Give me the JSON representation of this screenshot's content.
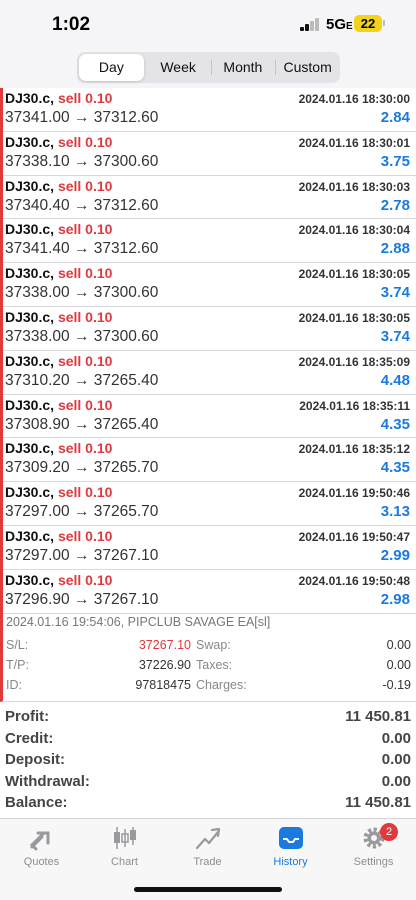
{
  "status": {
    "time": "1:02",
    "network": "5G",
    "network_suffix": "E",
    "battery": "22"
  },
  "tabs": [
    {
      "label": "Day",
      "active": true
    },
    {
      "label": "Week",
      "active": false
    },
    {
      "label": "Month",
      "active": false
    },
    {
      "label": "Custom",
      "active": false
    }
  ],
  "deals": [
    {
      "symbol": "DJ30.c,",
      "side": "sell 0.10",
      "datetime": "2024.01.16 18:30:00",
      "prices": "37341.00 → 37312.60",
      "profit": "2.84"
    },
    {
      "symbol": "DJ30.c,",
      "side": "sell 0.10",
      "datetime": "2024.01.16 18:30:01",
      "prices": "37338.10 → 37300.60",
      "profit": "3.75"
    },
    {
      "symbol": "DJ30.c,",
      "side": "sell 0.10",
      "datetime": "2024.01.16 18:30:03",
      "prices": "37340.40 → 37312.60",
      "profit": "2.78"
    },
    {
      "symbol": "DJ30.c,",
      "side": "sell 0.10",
      "datetime": "2024.01.16 18:30:04",
      "prices": "37341.40 → 37312.60",
      "profit": "2.88"
    },
    {
      "symbol": "DJ30.c,",
      "side": "sell 0.10",
      "datetime": "2024.01.16 18:30:05",
      "prices": "37338.00 → 37300.60",
      "profit": "3.74"
    },
    {
      "symbol": "DJ30.c,",
      "side": "sell 0.10",
      "datetime": "2024.01.16 18:30:05",
      "prices": "37338.00 → 37300.60",
      "profit": "3.74"
    },
    {
      "symbol": "DJ30.c,",
      "side": "sell 0.10",
      "datetime": "2024.01.16 18:35:09",
      "prices": "37310.20 → 37265.40",
      "profit": "4.48"
    },
    {
      "symbol": "DJ30.c,",
      "side": "sell 0.10",
      "datetime": "2024.01.16 18:35:11",
      "prices": "37308.90 → 37265.40",
      "profit": "4.35"
    },
    {
      "symbol": "DJ30.c,",
      "side": "sell 0.10",
      "datetime": "2024.01.16 18:35:12",
      "prices": "37309.20 → 37265.70",
      "profit": "4.35"
    },
    {
      "symbol": "DJ30.c,",
      "side": "sell 0.10",
      "datetime": "2024.01.16 19:50:46",
      "prices": "37297.00 → 37265.70",
      "profit": "3.13"
    },
    {
      "symbol": "DJ30.c,",
      "side": "sell 0.10",
      "datetime": "2024.01.16 19:50:47",
      "prices": "37297.00 → 37267.10",
      "profit": "2.99"
    },
    {
      "symbol": "DJ30.c,",
      "side": "sell 0.10",
      "datetime": "2024.01.16 19:50:48",
      "prices": "37296.90 → 37267.10",
      "profit": "2.98"
    }
  ],
  "detail": {
    "comment": "2024.01.16 19:54:06, PIPCLUB SAVAGE EA[sl]",
    "sl_label": "S/L:",
    "sl_value": "37267.10",
    "swap_label": "Swap:",
    "swap_value": "0.00",
    "tp_label": "T/P:",
    "tp_value": "37226.90",
    "taxes_label": "Taxes:",
    "taxes_value": "0.00",
    "id_label": "ID:",
    "id_value": "97818475",
    "charges_label": "Charges:",
    "charges_value": "-0.19"
  },
  "totals": [
    {
      "label": "Profit:",
      "value": "11 450.81"
    },
    {
      "label": "Credit:",
      "value": "0.00"
    },
    {
      "label": "Deposit:",
      "value": "0.00"
    },
    {
      "label": "Withdrawal:",
      "value": "0.00"
    },
    {
      "label": "Balance:",
      "value": "11 450.81"
    }
  ],
  "tabbar": [
    {
      "label": "Quotes",
      "icon": "quotes-icon",
      "active": false
    },
    {
      "label": "Chart",
      "icon": "candlestick-icon",
      "active": false
    },
    {
      "label": "Trade",
      "icon": "trade-icon",
      "active": false
    },
    {
      "label": "History",
      "icon": "inbox-icon",
      "active": true
    },
    {
      "label": "Settings",
      "icon": "gear-icon",
      "active": false,
      "badge": "2"
    }
  ],
  "colors": {
    "sell": "#e0393e",
    "profit": "#1a7ae0",
    "accent": "#1a7ae0",
    "badge": "#e0393e"
  }
}
